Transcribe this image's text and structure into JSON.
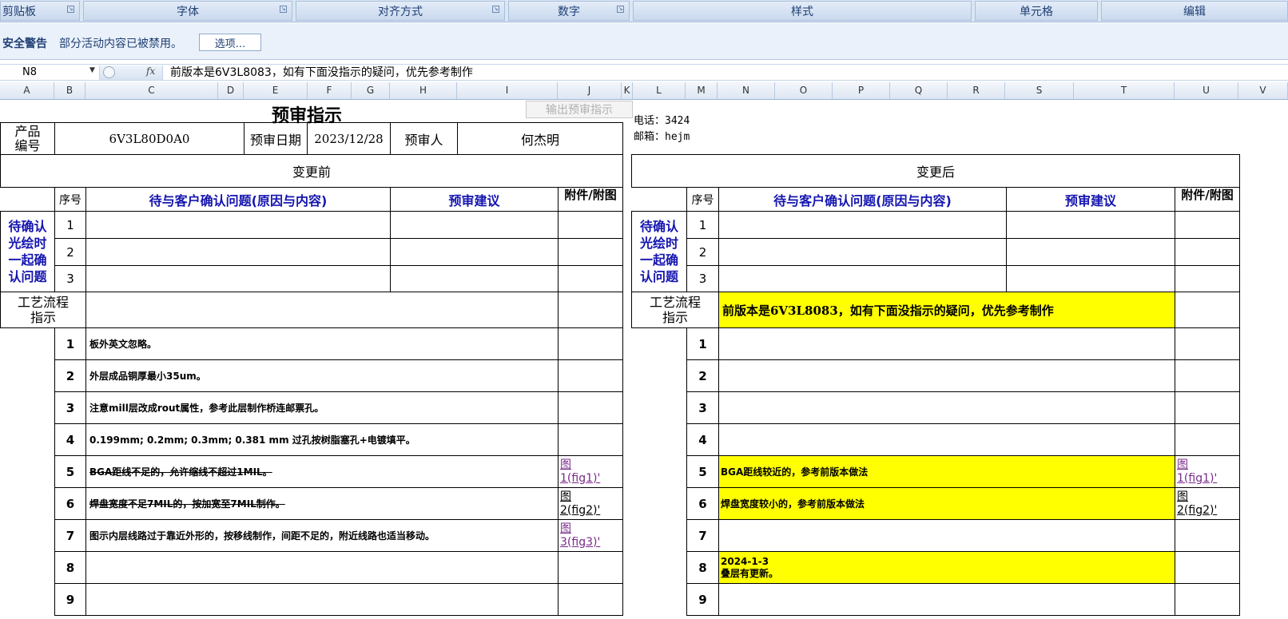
{
  "ribbon": {
    "groups": [
      "剪贴板",
      "字体",
      "对齐方式",
      "数字",
      "样式",
      "单元格",
      "编辑"
    ]
  },
  "security": {
    "title": "安全警告",
    "message": "部分活动内容已被禁用。",
    "options_button": "选项..."
  },
  "formula_bar": {
    "name_box": "N8",
    "fx": "fx",
    "formula": "前版本是6V3L8083，如有下面没指示的疑问，优先参考制作"
  },
  "columns": [
    "A",
    "B",
    "C",
    "D",
    "E",
    "F",
    "G",
    "H",
    "I",
    "J",
    "K",
    "L",
    "M",
    "N",
    "O",
    "P",
    "Q",
    "R",
    "S",
    "T",
    "U",
    "V"
  ],
  "sheet": {
    "title": "预审指示",
    "export_button": "输出预审指示",
    "phone": "电话：3424",
    "email": "邮箱：hejm",
    "header": {
      "product_label_1": "产品",
      "product_label_2": "编号",
      "product_no": "6V3L80D0A0",
      "date_label": "预审日期",
      "date": "2023/12/28",
      "reviewer_label": "预审人",
      "reviewer": "何杰明"
    },
    "before": {
      "title": "变更前",
      "seq_label": "序号",
      "question_label": "待与客户确认问题(原因与内容)",
      "advice_label": "预审建议",
      "attach_label": "附件/附图",
      "confirm_lines": [
        "待确认",
        "光绘时",
        "一起确",
        "认问题"
      ],
      "confirm_rows": [
        "1",
        "2",
        "3"
      ],
      "process_label_1": "工艺流程",
      "process_label_2": "指示",
      "rows": [
        {
          "no": "1",
          "text": "板外英文忽略。",
          "attach": ""
        },
        {
          "no": "2",
          "text": "外层成品铜厚最小35um。",
          "attach": ""
        },
        {
          "no": "3",
          "text": "注意mill层改成rout属性，参考此层制作桥连邮票孔。",
          "attach": ""
        },
        {
          "no": "4",
          "text": "0.199mm; 0.2mm; 0.3mm; 0.381 mm 过孔按树脂塞孔+电镀填平。",
          "attach": ""
        },
        {
          "no": "5",
          "text": "BGA距线不足的，允许缩线不超过1MIL。",
          "attach_1": "图",
          "attach_2": "1(fig1)'"
        },
        {
          "no": "6",
          "text": "焊盘宽度不足7MIL的，按加宽至7MIL制作。",
          "attach_1": "图",
          "attach_2": "2(fig2)'"
        },
        {
          "no": "7",
          "text": "图示内层线路过于靠近外形的，按移线制作，间距不足的，附近线路也适当移动。",
          "attach_1": "图",
          "attach_2": "3(fig3)'"
        },
        {
          "no": "8",
          "text": "",
          "attach": ""
        },
        {
          "no": "9",
          "text": "",
          "attach": ""
        }
      ]
    },
    "after": {
      "title": "变更后",
      "seq_label": "序号",
      "question_label": "待与客户确认问题(原因与内容)",
      "advice_label": "预审建议",
      "attach_label": "附件/附图",
      "confirm_lines": [
        "待确认",
        "光绘时",
        "一起确",
        "认问题"
      ],
      "confirm_rows": [
        "1",
        "2",
        "3"
      ],
      "process_label_1": "工艺流程",
      "process_label_2": "指示",
      "process_text": "前版本是6V3L8083，如有下面没指示的疑问，优先参考制作",
      "rows": [
        {
          "no": "1",
          "text": ""
        },
        {
          "no": "2",
          "text": ""
        },
        {
          "no": "3",
          "text": ""
        },
        {
          "no": "4",
          "text": ""
        },
        {
          "no": "5",
          "text": "BGA距线较近的，参考前版本做法",
          "attach_1": "图",
          "attach_2": "1(fig1)'"
        },
        {
          "no": "6",
          "text": "焊盘宽度较小的，参考前版本做法",
          "attach_1": "图",
          "attach_2": "2(fig2)'"
        },
        {
          "no": "7",
          "text": ""
        },
        {
          "no": "8",
          "text_1": "2024-1-3",
          "text_2": "叠层有更新。"
        },
        {
          "no": "9",
          "text": ""
        }
      ]
    }
  },
  "colors": {
    "highlight": "#ffff00",
    "header_blue": "#1515b0",
    "link_purple": "#7a2a8a",
    "ribbon_bg": "#dbe6f4"
  }
}
